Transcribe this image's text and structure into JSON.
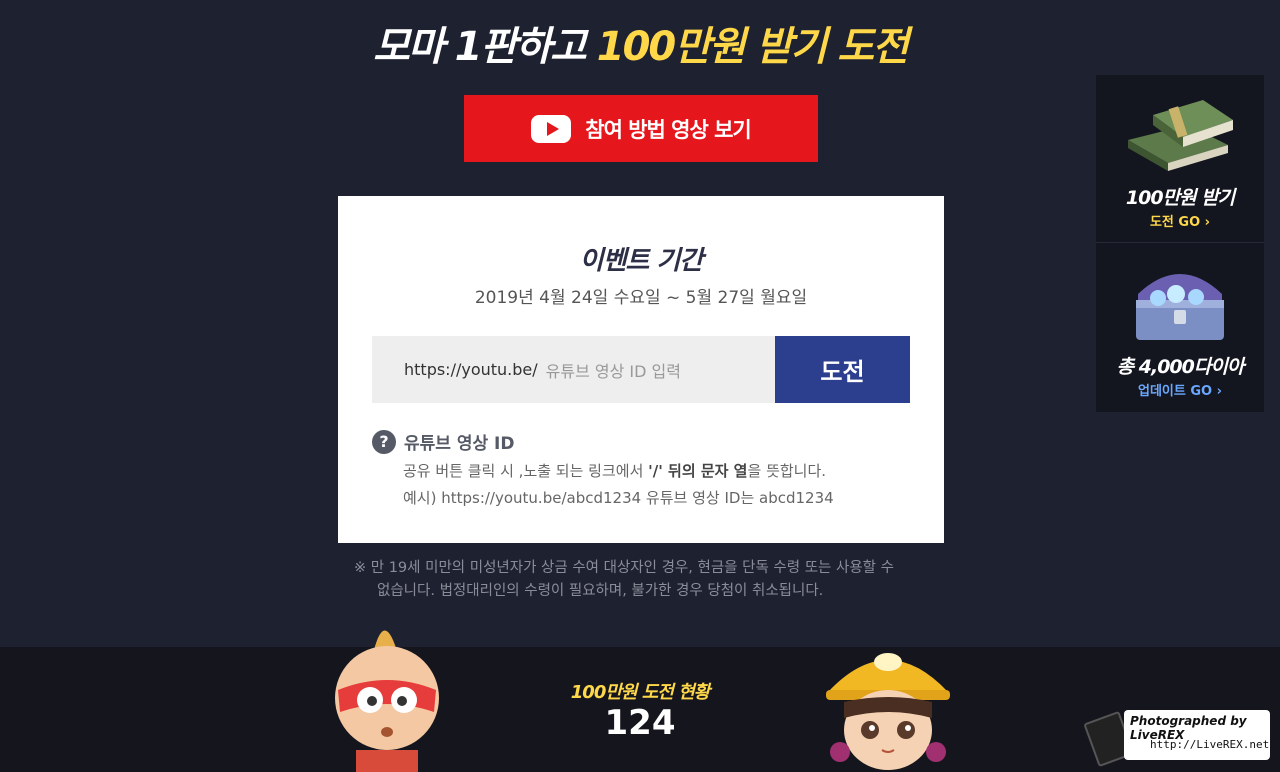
{
  "headline": {
    "part1": "모마 1판하고 ",
    "highlight": "100만원 받기 도전"
  },
  "video_button": {
    "label": "참여 방법 영상 보기",
    "icon": "youtube-play-icon"
  },
  "event": {
    "title": "이벤트 기간",
    "period": "2019년 4월 24일 수요일 ~ 5월 27일 월요일",
    "input_prefix": "https://youtu.be/",
    "input_placeholder": "유튜브 영상 ID 입력",
    "submit_label": "도전",
    "help_title": "유튜브 영상 ID",
    "help_line1_a": "공유 버튼 클릭 시 ,노출 되는 링크에서 ",
    "help_line1_b": "'/' 뒤의 문자 열",
    "help_line1_c": "을 뜻합니다.",
    "help_line2": "예시) https://youtu.be/abcd1234 유튜브 영상 ID는 abcd1234"
  },
  "notice": {
    "line1": "※  만 19세 미만의 미성년자가 상금 수여 대상자인 경우, 현금을 단독 수령 또는 사용할 수",
    "line2": "없습니다. 법정대리인의 수령이 필요하며, 불가한 경우 당첨이 취소됩니다."
  },
  "side_banner": {
    "item1_title": "100만원 받기",
    "item1_link": "도전 GO ›",
    "item2_title": "총 4,000다이아",
    "item2_link": "업데이트 GO ›"
  },
  "status": {
    "label": "100만원 도전 현황",
    "count": "124"
  },
  "watermark": {
    "line1": "Photographed by LiveREX",
    "line2": "http://LiveREX.net"
  },
  "colors": {
    "background": "#1e2130",
    "accent_red": "#e5161c",
    "accent_yellow": "#ffd84a",
    "button_blue": "#2c3f8f"
  }
}
